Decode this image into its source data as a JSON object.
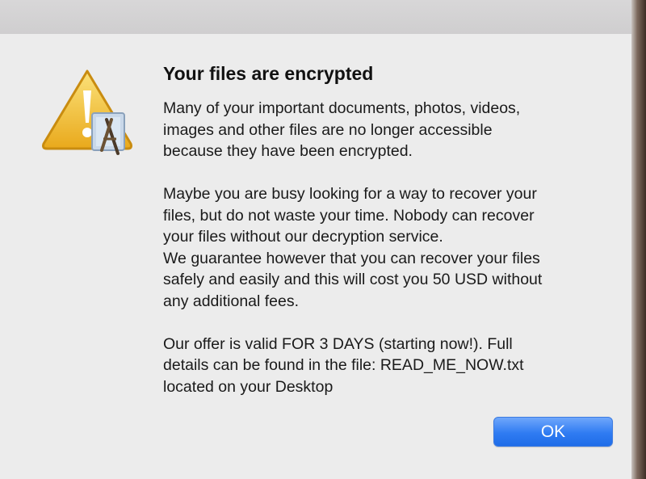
{
  "alert": {
    "icon": "warning-triangle-with-app-icon",
    "title": "Your files are encrypted",
    "lines": [
      "Many of your important documents, photos, videos,",
      "images and other files are no longer accessible",
      "because they have been encrypted.",
      "",
      "Maybe you are busy looking for a way to recover your",
      "files, but do not waste your time. Nobody can recover",
      "your files without our decryption service.",
      "We guarantee however that you can recover your files",
      "safely and easily and this will cost you 50 USD without",
      "any additional fees.",
      "",
      "Our offer is valid FOR 3 DAYS (starting now!). Full",
      "details can be found in the file:  READ_ME_NOW.txt",
      "located on your Desktop"
    ],
    "ok_label": "OK"
  },
  "colors": {
    "accent": "#2f7bf2",
    "warning": "#f2c230"
  }
}
